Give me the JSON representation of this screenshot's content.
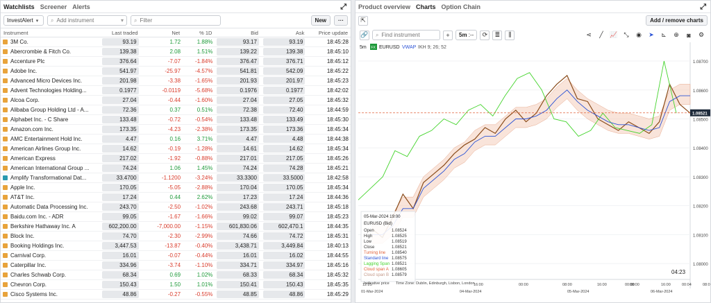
{
  "left": {
    "tabs": [
      "Watchlists",
      "Screener",
      "Alerts"
    ],
    "active_tab": "Watchlists",
    "list_select": "InvestAlert",
    "add_instrument_placeholder": "Add instrument",
    "filter_placeholder": "Filter",
    "new_label": "New",
    "more_label": "···",
    "columns": [
      "Instrument",
      "Last traded",
      "Net",
      "% 1D",
      "Bid",
      "Ask",
      "Price update"
    ],
    "rows": [
      {
        "name": "3M Co.",
        "type": "ES",
        "last": "93.19",
        "net": "1.72",
        "pct": "1.88%",
        "bid": "93.17",
        "ask": "93.19",
        "time": "18:45:28",
        "dir": "pos"
      },
      {
        "name": "Abercrombie & Fitch Co.",
        "type": "ES",
        "last": "139.38",
        "net": "2.08",
        "pct": "1.51%",
        "bid": "139.22",
        "ask": "139.38",
        "time": "18:45:10",
        "dir": "pos"
      },
      {
        "name": "Accenture Plc",
        "type": "ES",
        "last": "376.64",
        "net": "-7.07",
        "pct": "-1.84%",
        "bid": "376.47",
        "ask": "376.71",
        "time": "18:45:12",
        "dir": "neg"
      },
      {
        "name": "Adobe Inc.",
        "type": "ES",
        "last": "541.97",
        "net": "-25.97",
        "pct": "-4.57%",
        "bid": "541.81",
        "ask": "542.09",
        "time": "18:45:22",
        "dir": "neg"
      },
      {
        "name": "Advanced Micro Devices Inc.",
        "type": "ES",
        "last": "201.98",
        "net": "-3.38",
        "pct": "-1.65%",
        "bid": "201.93",
        "ask": "201.97",
        "time": "18:45:23",
        "dir": "neg"
      },
      {
        "name": "Advent Technologies Holding...",
        "type": "ES",
        "last": "0.1977",
        "net": "-0.0119",
        "pct": "-5.68%",
        "bid": "0.1976",
        "ask": "0.1977",
        "time": "18:42:02",
        "dir": "neg"
      },
      {
        "name": "Alcoa Corp.",
        "type": "ES",
        "last": "27.04",
        "net": "-0.44",
        "pct": "-1.60%",
        "bid": "27.04",
        "ask": "27.05",
        "time": "18:45:32",
        "dir": "neg"
      },
      {
        "name": "Alibaba Group Holding Ltd - A...",
        "type": "ES",
        "last": "72.36",
        "net": "0.37",
        "pct": "0.51%",
        "bid": "72.38",
        "ask": "72.40",
        "time": "18:44:59",
        "dir": "pos"
      },
      {
        "name": "Alphabet Inc. - C Share",
        "type": "ES",
        "last": "133.48",
        "net": "-0.72",
        "pct": "-0.54%",
        "bid": "133.48",
        "ask": "133.49",
        "time": "18:45:30",
        "dir": "neg"
      },
      {
        "name": "Amazon.com Inc.",
        "type": "ES",
        "last": "173.35",
        "net": "-4.23",
        "pct": "-2.38%",
        "bid": "173.35",
        "ask": "173.36",
        "time": "18:45:34",
        "dir": "neg"
      },
      {
        "name": "AMC Entertainment Hold Inc.",
        "type": "ES",
        "last": "4.47",
        "net": "0.16",
        "pct": "3.71%",
        "bid": "4.47",
        "ask": "4.48",
        "time": "18:44:38",
        "dir": "pos"
      },
      {
        "name": "American Airlines Group Inc.",
        "type": "ES",
        "last": "14.62",
        "net": "-0.19",
        "pct": "-1.28%",
        "bid": "14.61",
        "ask": "14.62",
        "time": "18:45:34",
        "dir": "neg"
      },
      {
        "name": "American Express",
        "type": "ES",
        "last": "217.02",
        "net": "-1.92",
        "pct": "-0.88%",
        "bid": "217.01",
        "ask": "217.05",
        "time": "18:45:26",
        "dir": "neg"
      },
      {
        "name": "American International Group ...",
        "type": "ES",
        "last": "74.24",
        "net": "1.06",
        "pct": "1.45%",
        "bid": "74.24",
        "ask": "74.28",
        "time": "18:45:21",
        "dir": "pos"
      },
      {
        "name": "Amplify Transformational Dat...",
        "type": "ETF",
        "last": "33.4700",
        "net": "-1.1200",
        "pct": "-3.24%",
        "bid": "33.3300",
        "ask": "33.5000",
        "time": "18:42:58",
        "dir": "neg"
      },
      {
        "name": "Apple Inc.",
        "type": "ES",
        "last": "170.05",
        "net": "-5.05",
        "pct": "-2.88%",
        "bid": "170.04",
        "ask": "170.05",
        "time": "18:45:34",
        "dir": "neg"
      },
      {
        "name": "AT&T Inc.",
        "type": "ES",
        "last": "17.24",
        "net": "0.44",
        "pct": "2.62%",
        "bid": "17.23",
        "ask": "17.24",
        "time": "18:44:36",
        "dir": "pos"
      },
      {
        "name": "Automatic Data Processing Inc.",
        "type": "ES",
        "last": "243.70",
        "net": "-2.50",
        "pct": "-1.02%",
        "bid": "243.68",
        "ask": "243.71",
        "time": "18:45:18",
        "dir": "neg"
      },
      {
        "name": "Baidu.com Inc. - ADR",
        "type": "ES",
        "last": "99.05",
        "net": "-1.67",
        "pct": "-1.66%",
        "bid": "99.02",
        "ask": "99.07",
        "time": "18:45:23",
        "dir": "neg"
      },
      {
        "name": "Berkshire Hathaway Inc. A",
        "type": "ES",
        "last": "602,200.00",
        "net": "-7,000.00",
        "pct": "-1.15%",
        "bid": "601,830.06",
        "ask": "602,470.1",
        "time": "18:44:35",
        "dir": "neg"
      },
      {
        "name": "Block Inc.",
        "type": "ES",
        "last": "74.70",
        "net": "-2.30",
        "pct": "-2.99%",
        "bid": "74.66",
        "ask": "74.72",
        "time": "18:45:31",
        "dir": "neg"
      },
      {
        "name": "Booking Holdings Inc.",
        "type": "ES",
        "last": "3,447.53",
        "net": "-13.87",
        "pct": "-0.40%",
        "bid": "3,438.71",
        "ask": "3,449.84",
        "time": "18:40:13",
        "dir": "neg"
      },
      {
        "name": "Carnival Corp.",
        "type": "ES",
        "last": "16.01",
        "net": "-0.07",
        "pct": "-0.44%",
        "bid": "16.01",
        "ask": "16.02",
        "time": "18:44:55",
        "dir": "neg"
      },
      {
        "name": "Caterpillar Inc.",
        "type": "ES",
        "last": "334.96",
        "net": "-3.74",
        "pct": "-1.10%",
        "bid": "334.71",
        "ask": "334.97",
        "time": "18:45:16",
        "dir": "neg"
      },
      {
        "name": "Charles Schwab Corp.",
        "type": "ES",
        "last": "68.34",
        "net": "0.69",
        "pct": "1.02%",
        "bid": "68.33",
        "ask": "68.34",
        "time": "18:45:32",
        "dir": "pos"
      },
      {
        "name": "Chevron Corp.",
        "type": "ES",
        "last": "150.43",
        "net": "1.50",
        "pct": "1.01%",
        "bid": "150.41",
        "ask": "150.43",
        "time": "18:45:35",
        "dir": "pos"
      },
      {
        "name": "Cisco Systems Inc.",
        "type": "ES",
        "last": "48.86",
        "net": "-0.27",
        "pct": "-0.55%",
        "bid": "48.85",
        "ask": "48.86",
        "time": "18:45:29",
        "dir": "neg"
      }
    ]
  },
  "right": {
    "tabs": [
      "Product overview",
      "Charts",
      "Option Chain"
    ],
    "active_tab": "Charts",
    "add_remove_label": "Add / remove charts",
    "find_placeholder": "Find instrument",
    "plus_label": "+",
    "interval": "5m",
    "interval_sub": ":--",
    "chart_interval": "5m",
    "badge": "FX",
    "symbol": "EURUSD",
    "indicator_vwap": "VWAP",
    "indicator_ikh": "IKH 9; 26; 52",
    "current_price": "1.08521",
    "timer": "04:23",
    "colors": {
      "up": "#1e9a3a",
      "down": "#d93b2b",
      "accent": "#2b53d6"
    },
    "tooltip": {
      "date": "05-Mar-2024 19:00",
      "symbol": "EURUSD (Bid)",
      "rows": [
        {
          "label": "Open",
          "value": "1.08524"
        },
        {
          "label": "High",
          "value": "1.08525"
        },
        {
          "label": "Low",
          "value": "1.08519"
        },
        {
          "label": "Close",
          "value": "1.08521"
        },
        {
          "label": "Turning line",
          "value": "1.08540",
          "color": "#e0623a"
        },
        {
          "label": "Standard line",
          "value": "1.08575",
          "color": "#2b53d6"
        },
        {
          "label": "Lagging Span",
          "value": "1.08521",
          "color": "#44d42c"
        },
        {
          "label": "Cloud span A",
          "value": "1.08605",
          "color": "#e0623a"
        },
        {
          "label": "Cloud span B",
          "value": "1.08579",
          "color": "#c49a8a"
        }
      ]
    },
    "indicative_price": "Indicative price",
    "timezone": "Time Zone: Dublin, Edinburgh, Lisbon, London",
    "chart_data": {
      "type": "line",
      "symbol": "EURUSD",
      "y_ticks": [
        "1.08700",
        "1.08600",
        "1.08500",
        "1.08400",
        "1.08300",
        "1.08200",
        "1.08100",
        "1.08000"
      ],
      "ylim": [
        1.0795,
        1.0876
      ],
      "x_ticks": [
        "12:25",
        "16:00",
        "00:00",
        "08:00",
        "16:00",
        "00:00",
        "08:00",
        "16:00",
        "00:04",
        "08:00"
      ],
      "x_dates": [
        "01-Mar-2024",
        "04-Mar-2024",
        "05-Mar-2024",
        "06-Mar-2024"
      ],
      "series": [
        {
          "name": "Close",
          "color": "#8a4b1a",
          "values": [
            1.0812,
            1.0809,
            1.0816,
            1.0824,
            1.0819,
            1.0828,
            1.0831,
            1.0834,
            1.0838,
            1.0841,
            1.0843,
            1.0847,
            1.0845,
            1.085,
            1.0853,
            1.0849,
            1.0852,
            1.0858,
            1.0862,
            1.0865,
            1.0857,
            1.0856,
            1.085,
            1.0848,
            1.0846,
            1.0849,
            1.0847,
            1.0845,
            1.0849,
            1.0862,
            1.0855,
            1.0852
          ]
        },
        {
          "name": "Lagging Span",
          "color": "#44d42c",
          "values": [
            1.0822,
            1.0826,
            1.083,
            1.0839,
            1.0837,
            1.0844,
            1.0846,
            1.085,
            1.0848,
            1.0853,
            1.0855,
            1.0851,
            1.0858,
            1.0864,
            1.0866,
            1.086,
            1.085,
            1.0849,
            1.0844,
            1.0846,
            1.0852,
            1.0847,
            1.0846,
            1.0845,
            1.0848,
            1.087,
            1.0852
          ]
        },
        {
          "name": "Standard line",
          "color": "#2b53d6",
          "values": [
            1.081,
            1.081,
            1.0813,
            1.0819,
            1.0819,
            1.0826,
            1.0829,
            1.0832,
            1.0836,
            1.0838,
            1.0842,
            1.0844,
            1.0844,
            1.0847,
            1.085,
            1.085,
            1.0851,
            1.0853,
            1.0857,
            1.086,
            1.0856,
            1.0853,
            1.0851,
            1.0849,
            1.0848,
            1.0848,
            1.0847,
            1.0846,
            1.0847,
            1.0856,
            1.0858,
            1.0858
          ]
        }
      ]
    }
  }
}
